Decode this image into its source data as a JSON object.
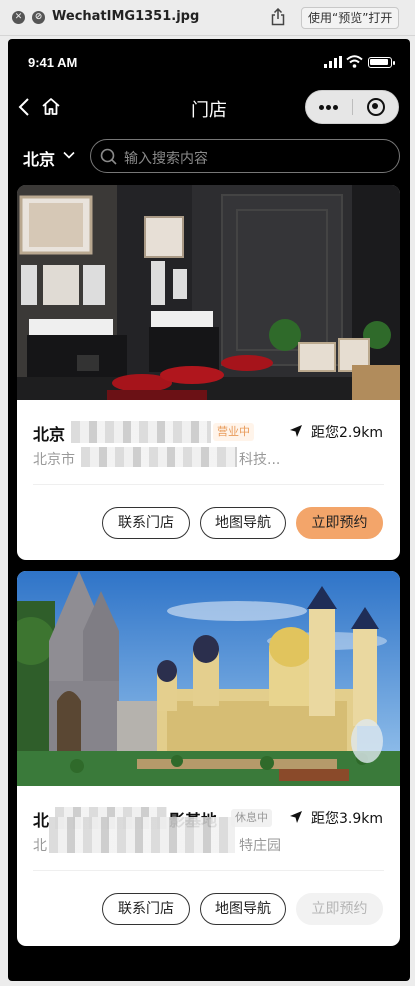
{
  "window": {
    "filename": "WechatIMG1351.jpg",
    "open_with_label": "使用“预览”打开"
  },
  "status_bar": {
    "time": "9:41 AM"
  },
  "navbar": {
    "title": "门店"
  },
  "search": {
    "city": "北京",
    "placeholder": "输入搜索内容"
  },
  "stores": [
    {
      "name_visible": "北京",
      "status": "营业中",
      "distance": "距您2.9km",
      "address_start": "北京市",
      "address_end": "科技...",
      "buttons": {
        "contact": "联系门店",
        "map": "地图导航",
        "book": "立即预约"
      },
      "booking_enabled": true
    },
    {
      "name_visible": "北",
      "name_end": "影基地",
      "status": "休息中",
      "distance": "距您3.9km",
      "address_start": "北",
      "address_end": "特庄园",
      "buttons": {
        "contact": "联系门店",
        "map": "地图导航",
        "book": "立即预约"
      },
      "booking_enabled": false
    }
  ],
  "colors": {
    "accent": "#f3a56a",
    "open_badge": "#e89b5a",
    "background": "#000000"
  }
}
